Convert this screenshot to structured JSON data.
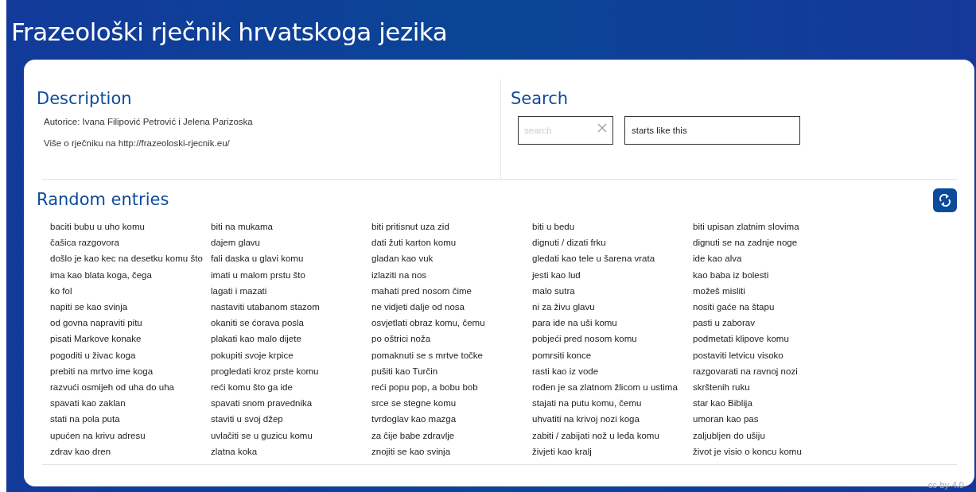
{
  "title": "Frazeološki rječnik hrvatskoga jezika",
  "description": {
    "heading": "Description",
    "lines": [
      "Autorice: Ivana Filipović Petrović i Jelena Parizoska",
      "Više o rječniku na http://frazeoloski-rjecnik.eu/"
    ]
  },
  "search": {
    "heading": "Search",
    "placeholder": "search",
    "match_mode": "starts like this"
  },
  "random_entries": {
    "heading": "Random entries",
    "entries": [
      "baciti bubu u uho komu",
      "biti na mukama",
      "biti pritisnut uza zid",
      "biti u bedu",
      "biti upisan zlatnim slovima",
      "čašica razgovora",
      "dajem glavu",
      "dati žuti karton komu",
      "dignuti / dizati frku",
      "dignuti se na zadnje noge",
      "došlo je kao kec na desetku komu što",
      "fali daska u glavi komu",
      "gladan kao vuk",
      "gledati kao tele u šarena vrata",
      "ide kao alva",
      "ima kao blata koga, čega",
      "imati u malom prstu što",
      "izlaziti na nos",
      "jesti kao lud",
      "kao baba iz bolesti",
      "ko fol",
      "lagati i mazati",
      "mahati pred nosom čime",
      "malo sutra",
      "možeš misliti",
      "napiti se kao svinja",
      "nastaviti utabanom stazom",
      "ne vidjeti dalje od nosa",
      "ni za živu glavu",
      "nositi gaće na štapu",
      "od govna napraviti pitu",
      "okaniti se ćorava posla",
      "osvjetlati obraz komu, čemu",
      "para ide na uši komu",
      "pasti u zaborav",
      "pisati Markove konake",
      "plakati kao malo dijete",
      "po oštrici noža",
      "pobjeći pred nosom komu",
      "podmetati klipove komu",
      "pogoditi u živac koga",
      "pokupiti svoje krpice",
      "pomaknuti se s mrtve točke",
      "pomrsiti konce",
      "postaviti letvicu visoko",
      "prebiti na mrtvo ime koga",
      "progledati kroz prste komu",
      "pušiti kao Turčin",
      "rasti kao iz vode",
      "razgovarati na ravnoj nozi",
      "razvući osmijeh od uha do uha",
      "reći komu što ga ide",
      "reći popu pop, a bobu bob",
      "rođen je sa zlatnom žlicom u ustima",
      "skrštenih ruku",
      "spavati kao zaklan",
      "spavati snom pravednika",
      "srce se stegne komu",
      "stajati na putu komu, čemu",
      "star kao Biblija",
      "stati na pola puta",
      "staviti u svoj džep",
      "tvrdoglav kao mazga",
      "uhvatiti na krivoj nozi koga",
      "umoran kao pas",
      "upućen na krivu adresu",
      "uvlačiti se u guzicu komu",
      "za čije babe zdravlje",
      "zabiti / zabijati nož u leđa komu",
      "zaljubljen do ušiju",
      "zdrav kao dren",
      "zlatna koka",
      "znojiti se kao svinja",
      "živjeti kao kralj",
      "život je visio o koncu komu"
    ]
  },
  "license": "cc-by-4.0"
}
